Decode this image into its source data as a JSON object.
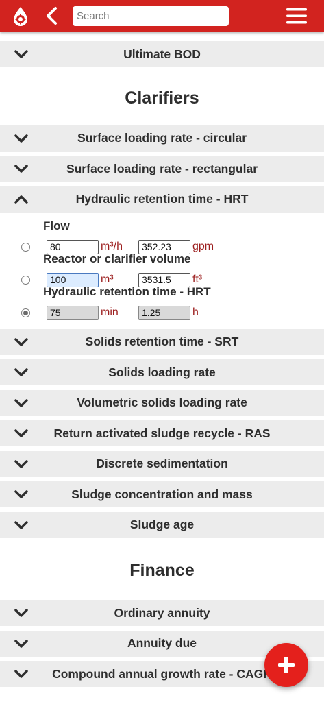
{
  "header": {
    "search_placeholder": "Search"
  },
  "icons": {
    "logo": "water-drop-gear-icon",
    "back": "chevron-left-icon",
    "menu": "hamburger-menu-icon",
    "collapsed": "chevron-down-icon",
    "expanded": "chevron-up-icon",
    "add": "plus-icon"
  },
  "colors": {
    "brand": "#d2231f",
    "accordion_bg": "#ececec",
    "unit_text": "#9c1e1e",
    "fab": "#e4201c"
  },
  "sections": {
    "prev_last": "Ultimate BOD",
    "clarifiers_title": "Clarifiers",
    "clarifiers": [
      "Surface loading rate - circular",
      "Surface loading rate - rectangular",
      "Hydraulic retention time - HRT",
      "Solids retention time - SRT",
      "Solids loading rate",
      "Volumetric solids loading rate",
      "Return activated sludge recycle - RAS",
      "Discrete sedimentation",
      "Sludge concentration and mass",
      "Sludge age"
    ],
    "finance_title": "Finance",
    "finance": [
      "Ordinary annuity",
      "Annuity due",
      "Compound annual growth rate - CAGR"
    ]
  },
  "hrt_form": {
    "flow": {
      "label": "Flow",
      "value1": "80",
      "unit1": "m³/h",
      "value2": "352.23",
      "unit2": "gpm",
      "selected": false
    },
    "volume": {
      "label": "Reactor or clarifier volume",
      "value1": "100",
      "unit1": "m³",
      "value2": "3531.5",
      "unit2": "ft³",
      "selected": false
    },
    "hrt": {
      "label": "Hydraulic retention time - HRT",
      "value1": "75",
      "unit1": "min",
      "value2": "1.25",
      "unit2": "h",
      "selected": true
    }
  }
}
